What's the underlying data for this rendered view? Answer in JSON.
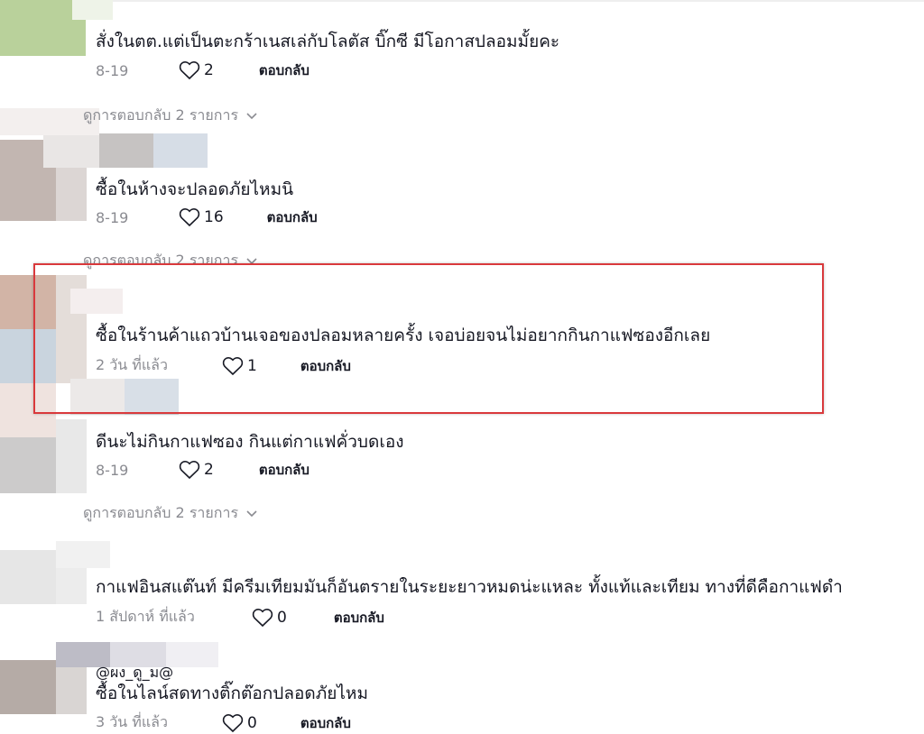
{
  "comments": [
    {
      "text": "สั่งในตต.แต่เป็นตะกร้าเนสเล่กับโลตัส บิ๊กซี มีโอกาสปลอมมั้ยคะ",
      "date": "8-19",
      "likes": "2",
      "reply": "ตอบกลับ",
      "view_replies": "ดูการตอบกลับ 2 รายการ"
    },
    {
      "text": "ซื้อในห้างจะปลอดภัยไหมนิ",
      "date": "8-19",
      "likes": "16",
      "reply": "ตอบกลับ",
      "view_replies": "ดูการตอบกลับ 2 รายการ"
    },
    {
      "text": "ซื้อในร้านค้าแถวบ้านเจอของปลอมหลายครั้ง เจอบ่อยจนไม่อยากกินกาแฟซองอีกเลย",
      "date": "2 วัน ที่แล้ว",
      "likes": "1",
      "reply": "ตอบกลับ"
    },
    {
      "text": "ดีนะไม่กินกาแฟซอง กินแต่กาแฟคั่วบดเอง",
      "date": "8-19",
      "likes": "2",
      "reply": "ตอบกลับ",
      "view_replies": "ดูการตอบกลับ 2 รายการ"
    },
    {
      "text": "กาแฟอินสแต๊นท์ มีครีมเทียมมันก็อันตรายในระยะยาวหมดน่ะแหละ ทั้งแท้และเทียม ทางที่ดีคือกาแฟดำ",
      "date": "1 สัปดาห์ ที่แล้ว",
      "likes": "0",
      "reply": "ตอบกลับ"
    },
    {
      "mention": "@ผง_ดู_ม@",
      "text": "ซื้อในไลน์สดทางติ๊กต๊อกปลอดภัยไหม",
      "date": "3 วัน ที่แล้ว",
      "likes": "0",
      "reply": "ตอบกลับ"
    }
  ],
  "colors": {
    "highlight": "#d9393c",
    "meta": "#8a8b91",
    "text": "#161823"
  },
  "icons": {
    "like": "heart-outline-icon",
    "expand": "chevron-down-icon"
  }
}
